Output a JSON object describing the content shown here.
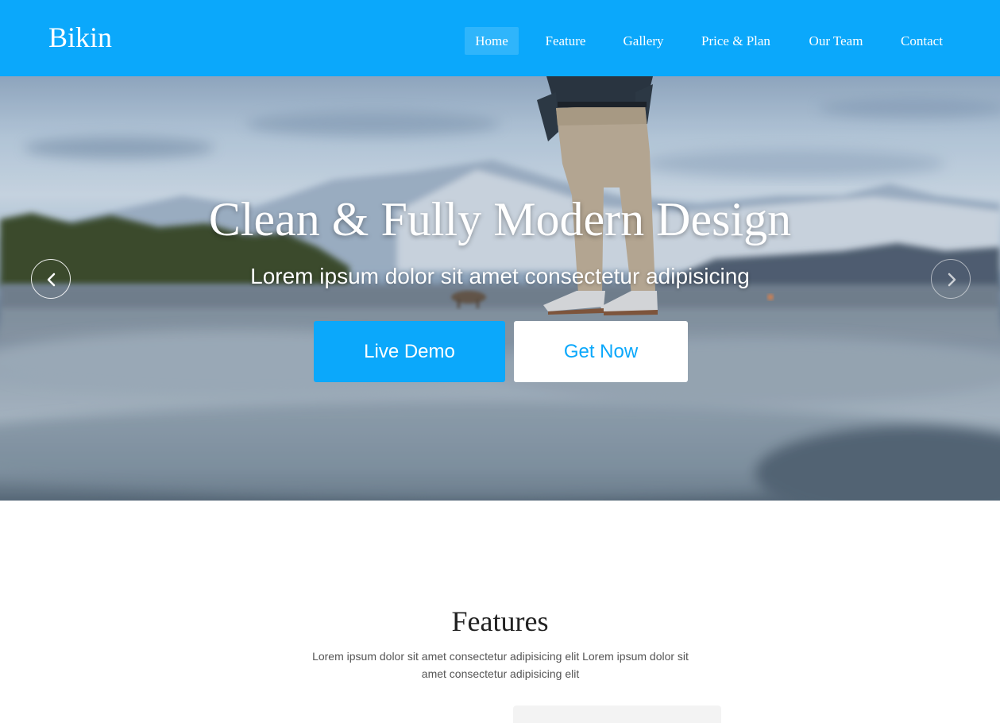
{
  "header": {
    "brand": "Bikin",
    "nav": [
      {
        "label": "Home",
        "active": true
      },
      {
        "label": "Feature",
        "active": false
      },
      {
        "label": "Gallery",
        "active": false
      },
      {
        "label": "Price & Plan",
        "active": false
      },
      {
        "label": "Our Team",
        "active": false
      },
      {
        "label": "Contact",
        "active": false
      }
    ]
  },
  "hero": {
    "title": "Clean & Fully Modern Design",
    "subtitle": "Lorem ipsum dolor sit amet consectetur adipisicing",
    "primary_button": "Live Demo",
    "secondary_button": "Get Now",
    "prev_icon": "chevron-left-icon",
    "next_icon": "chevron-right-icon"
  },
  "features": {
    "title": "Features",
    "description": "Lorem ipsum dolor sit amet consectetur adipisicing elit Lorem ipsum dolor sit amet consectetur adipisicing elit"
  },
  "colors": {
    "accent": "#0ba8fb",
    "white": "#ffffff",
    "heading": "#222222",
    "body_text": "#555555"
  }
}
